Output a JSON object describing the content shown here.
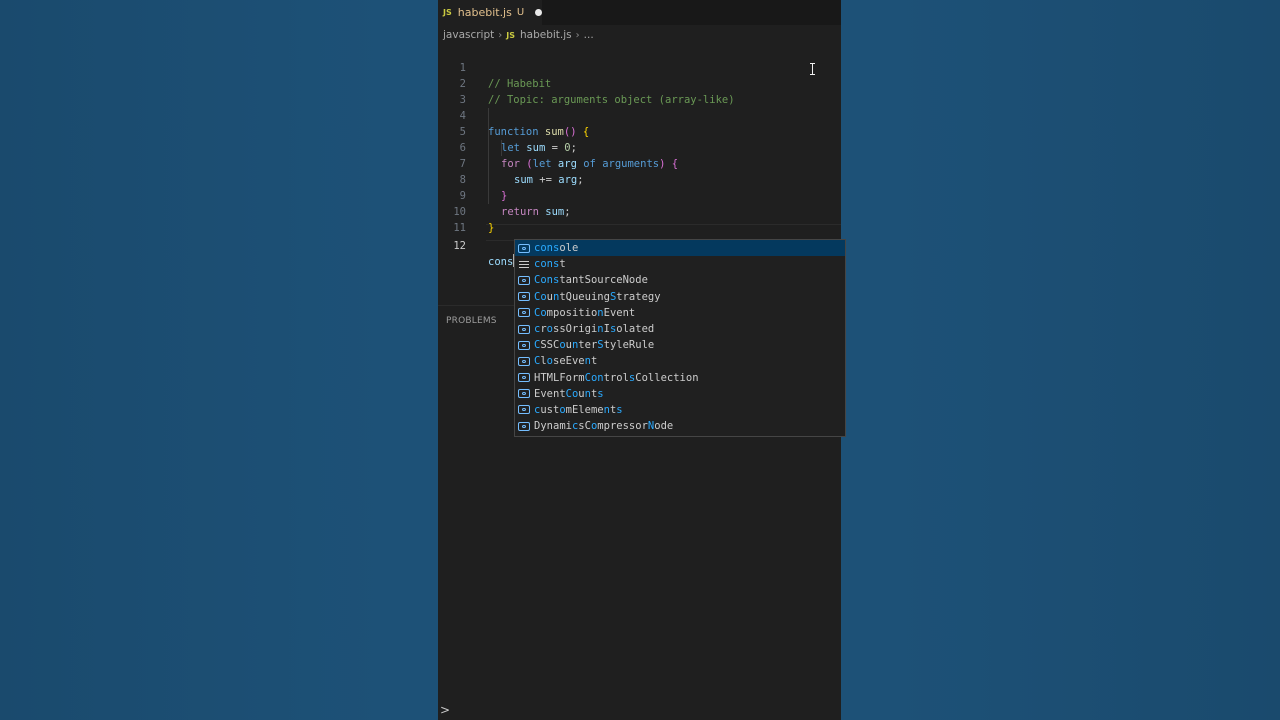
{
  "tab": {
    "badge": "JS",
    "label": "habebit.js",
    "status": "U"
  },
  "breadcrumb": {
    "folder": "javascript",
    "badge": "JS",
    "file": "habebit.js",
    "more": "..."
  },
  "code": {
    "line_numbers": [
      "1",
      "2",
      "3",
      "4",
      "5",
      "6",
      "7",
      "8",
      "9",
      "10",
      "11",
      "12"
    ],
    "l1": "// Habebit",
    "l2": "// Topic: arguments object (array-like)",
    "l4_kw": "function",
    "l4_fn": "sum",
    "l4_paren": "()",
    "l4_brace": "{",
    "l5_kw": "let",
    "l5_var": "sum",
    "l5_op": " = ",
    "l5_num": "0",
    "l5_semi": ";",
    "l6_kw": "for",
    "l6_open": "(",
    "l6_let": "let",
    "l6_var": "arg",
    "l6_of": "of",
    "l6_args": "arguments",
    "l6_close": ")",
    "l6_brace": "{",
    "l7_var": "sum",
    "l7_op": " += ",
    "l7_var2": "arg",
    "l7_semi": ";",
    "l8_brace": "}",
    "l9_kw": "return",
    "l9_var": "sum",
    "l9_semi": ";",
    "l10_brace": "}",
    "l12_typed": "cons"
  },
  "panel": {
    "title": "PROBLEMS",
    "prompt": ">"
  },
  "suggestions": [
    {
      "label": "console",
      "kind": "variable-icon"
    },
    {
      "label": "const",
      "kind": "keyword-icon"
    },
    {
      "label": "ConstantSourceNode",
      "kind": "variable-icon"
    },
    {
      "label": "CountQueuingStrategy",
      "kind": "variable-icon"
    },
    {
      "label": "CompositionEvent",
      "kind": "variable-icon"
    },
    {
      "label": "crossOriginIsolated",
      "kind": "variable-icon"
    },
    {
      "label": "CSSCounterStyleRule",
      "kind": "variable-icon"
    },
    {
      "label": "CloseEvent",
      "kind": "variable-icon"
    },
    {
      "label": "HTMLFormControlsCollection",
      "kind": "variable-icon"
    },
    {
      "label": "EventCounts",
      "kind": "variable-icon"
    },
    {
      "label": "customElements",
      "kind": "variable-icon"
    },
    {
      "label": "DynamicsCompressorNode",
      "kind": "variable-icon"
    }
  ],
  "colors": {
    "background": "#1d5177",
    "editor": "#1f1f1f",
    "match_highlight": "#2aaaff",
    "selected_row": "#04395e"
  }
}
